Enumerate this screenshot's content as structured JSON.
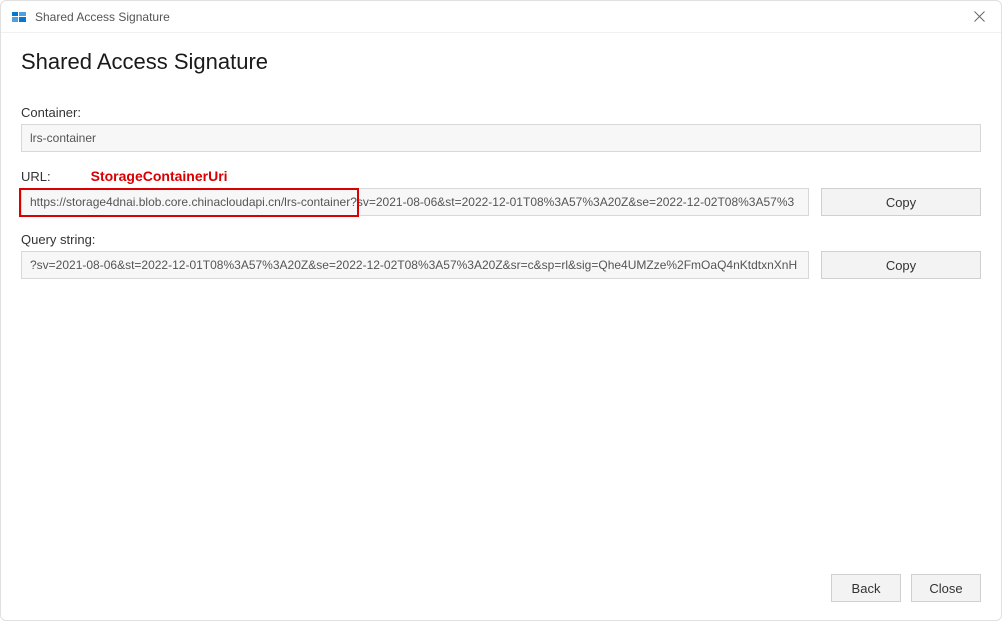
{
  "titlebar": {
    "title": "Shared Access Signature"
  },
  "heading": "Shared Access Signature",
  "annotation": "StorageContainerUri",
  "fields": {
    "container": {
      "label": "Container:",
      "value": "lrs-container"
    },
    "url": {
      "label": "URL:",
      "value": "https://storage4dnai.blob.core.chinacloudapi.cn/lrs-container?sv=2021-08-06&st=2022-12-01T08%3A57%3A20Z&se=2022-12-02T08%3A57%3",
      "copy_label": "Copy"
    },
    "query_string": {
      "label": "Query string:",
      "value": "?sv=2021-08-06&st=2022-12-01T08%3A57%3A20Z&se=2022-12-02T08%3A57%3A20Z&sr=c&sp=rl&sig=Qhe4UMZze%2FmOaQ4nKtdtxnXnH",
      "copy_label": "Copy"
    }
  },
  "footer": {
    "back_label": "Back",
    "close_label": "Close"
  },
  "colors": {
    "annotation_red": "#d80000"
  }
}
